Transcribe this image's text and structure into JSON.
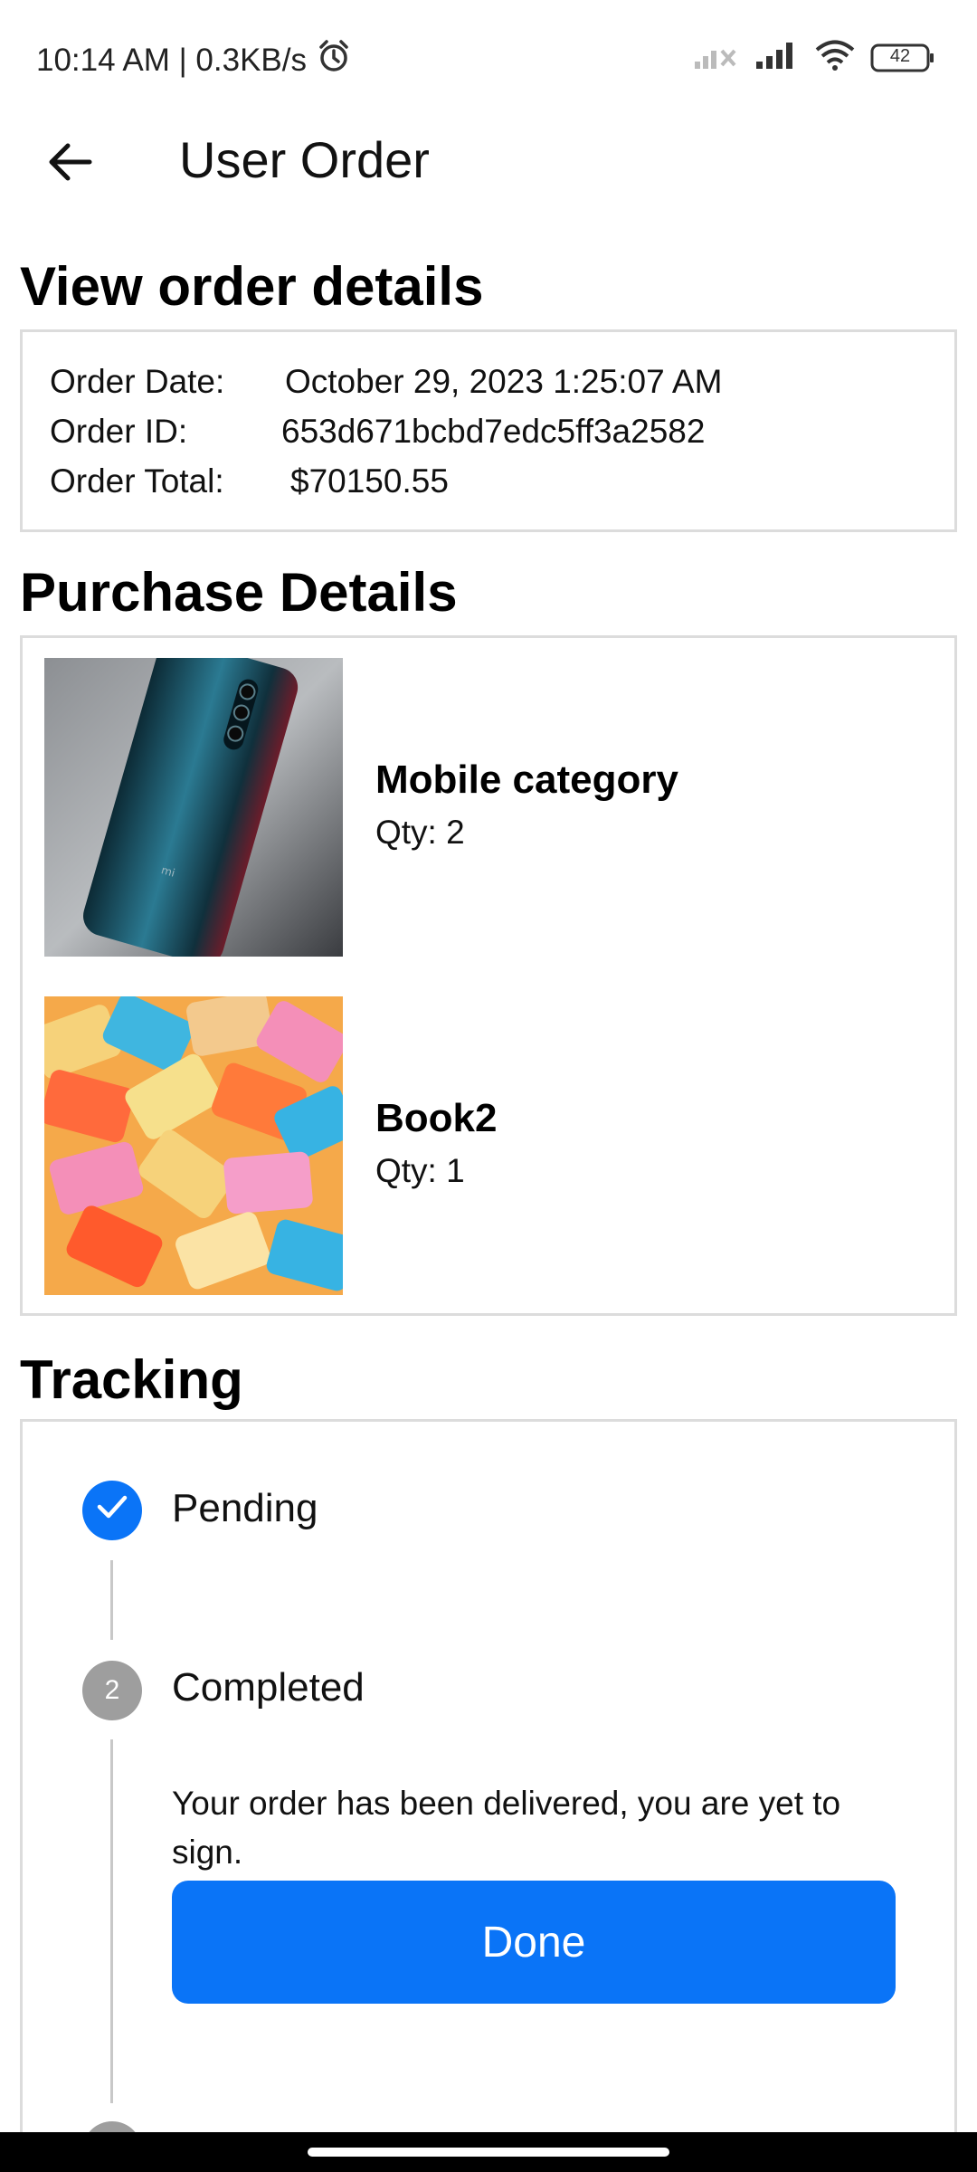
{
  "status_bar": {
    "time_speed": "10:14 AM | 0.3KB/s",
    "battery": "42"
  },
  "app_bar": {
    "title": "User Order"
  },
  "order_details": {
    "section_title": "View order details",
    "rows": [
      {
        "label": "Order Date:",
        "value": "October 29, 2023 1:25:07 AM"
      },
      {
        "label": "Order ID:",
        "value": "653d671bcbd7edc5ff3a2582"
      },
      {
        "label": "Order Total:",
        "value": "$70150.55"
      }
    ]
  },
  "purchase_details": {
    "section_title": "Purchase Details",
    "items": [
      {
        "name": "Mobile category",
        "qty": "Qty: 2"
      },
      {
        "name": "Book2",
        "qty": "Qty: 1"
      }
    ]
  },
  "tracking": {
    "section_title": "Tracking",
    "steps": [
      {
        "label": "Pending",
        "state": "done"
      },
      {
        "label": "Completed",
        "number": "2",
        "state": "current",
        "description": "Your order has been delivered, you are yet to sign."
      }
    ],
    "done_button": "Done"
  },
  "colors": {
    "accent": "#0a74f7",
    "inactive_step": "#9e9e9e",
    "card_border": "#dcdcdc"
  },
  "icons": [
    "alarm-icon",
    "signal-weak-icon",
    "signal-icon",
    "wifi-icon",
    "battery-icon",
    "back-arrow-icon",
    "check-icon"
  ]
}
